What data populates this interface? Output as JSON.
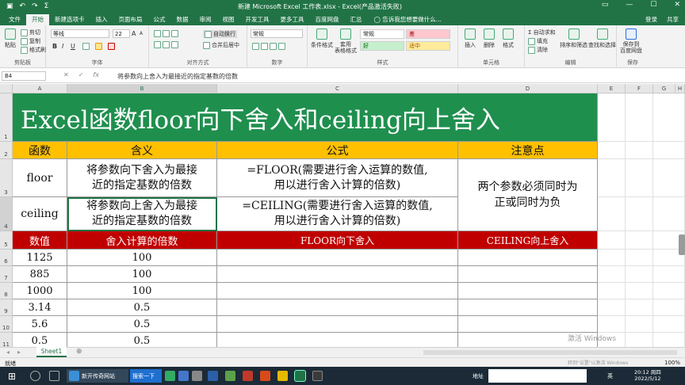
{
  "titlebar": {
    "title": "新建 Microsoft Excel 工作表.xlsx - Excel(产品激活失败)",
    "qa_save": "▣",
    "qa_undo": "↶",
    "qa_redo": "↷",
    "qa_sigma": "Σ",
    "wc_restore": "▭",
    "wc_min": "—",
    "wc_max": "☐",
    "wc_close": "✕"
  },
  "menu": {
    "items": [
      "文件",
      "开始",
      "新建选项卡",
      "插入",
      "页面布局",
      "公式",
      "数据",
      "审阅",
      "视图",
      "开发工具",
      "更多工具",
      "百度网盘",
      "汇总"
    ],
    "tell": "◯ 告诉我您想要做什么...",
    "login": "登录",
    "share": "共享"
  },
  "ribbon": {
    "clipboard": {
      "paste": "粘贴",
      "cut": "剪切",
      "copy": "复制",
      "format_painter": "格式刷",
      "label": "剪贴板"
    },
    "font": {
      "name": "等线",
      "size": "22",
      "bold": "B",
      "italic": "I",
      "underline": "U",
      "grow": "A",
      "shrink": "A",
      "label": "字体"
    },
    "alignment": {
      "wrap": "自动换行",
      "merge": "合并后居中",
      "label": "对齐方式"
    },
    "number": {
      "format": "常规",
      "label": "数字"
    },
    "styles": {
      "cond": "条件格式",
      "table": "套用\n表格格式",
      "normal": "常规",
      "bad": "差",
      "good": "好",
      "neutral": "适中",
      "label": "样式"
    },
    "cells": {
      "insert": "插入",
      "delete": "删除",
      "format": "格式",
      "label": "单元格"
    },
    "editing": {
      "autosum": "Σ 自动求和",
      "fill": "填充",
      "clear": "清除",
      "sort": "排序和筛选",
      "find": "查找和选择",
      "label": "编辑"
    },
    "save": {
      "btn": "保存到\n百度网盘",
      "label": "保存"
    }
  },
  "formula_bar": {
    "namebox": "B4",
    "fx": "fx",
    "formula": "将参数向上舍入为最接近的指定基数的倍数"
  },
  "grid": {
    "columns": [
      "A",
      "B",
      "C",
      "D",
      "E",
      "F",
      "G",
      "H"
    ],
    "rows": [
      "1",
      "2",
      "3",
      "4",
      "5",
      "6",
      "7",
      "8",
      "9",
      "10",
      "11"
    ],
    "title": "Excel函数floor向下舍入和ceiling向上舍入",
    "header": [
      "函数",
      "含义",
      "公式",
      "注意点"
    ],
    "floor": {
      "name": "floor",
      "desc": "将参数向下舍入为最接\n近的指定基数的倍数",
      "formula": "=FLOOR(需要进行舍入运算的数值,\n用以进行舍入计算的倍数)"
    },
    "ceiling": {
      "name": "ceiling",
      "desc": "将参数向上舍入为最接\n近的指定基数的倍数",
      "formula": "=CEILING(需要进行舍入运算的数值,\n用以进行舍入计算的倍数)"
    },
    "note": "两个参数必须同时为\n正或同时为负",
    "red_header": [
      "数值",
      "舍入计算的倍数",
      "FLOOR向下舍入",
      "CEILING向上舍入"
    ],
    "data": [
      [
        "1125",
        "100"
      ],
      [
        "885",
        "100"
      ],
      [
        "1000",
        "100"
      ],
      [
        "3.14",
        "0.5"
      ],
      [
        "5.6",
        "0.5"
      ],
      [
        "0.5",
        "0.5"
      ]
    ]
  },
  "sheet": {
    "tab": "Sheet1",
    "add": "⊕",
    "nav_prev": "◂",
    "nav_next": "▸"
  },
  "status": {
    "ready": "就绪",
    "zoom": "100%"
  },
  "watermark": {
    "line1": "激活 Windows",
    "line2": "转到\"设置\"以激活 Windows"
  },
  "taskbar": {
    "start": "⊞",
    "browser": "新开传奇网站",
    "search": "搜索一下",
    "address": "地址",
    "ime": "英",
    "time": "20:12 周四",
    "date": "2022/5/12"
  },
  "colors": {
    "excel_green": "#217346",
    "title_green": "#1f8f4e",
    "header_yellow": "#ffc000",
    "red_row": "#c00000"
  }
}
